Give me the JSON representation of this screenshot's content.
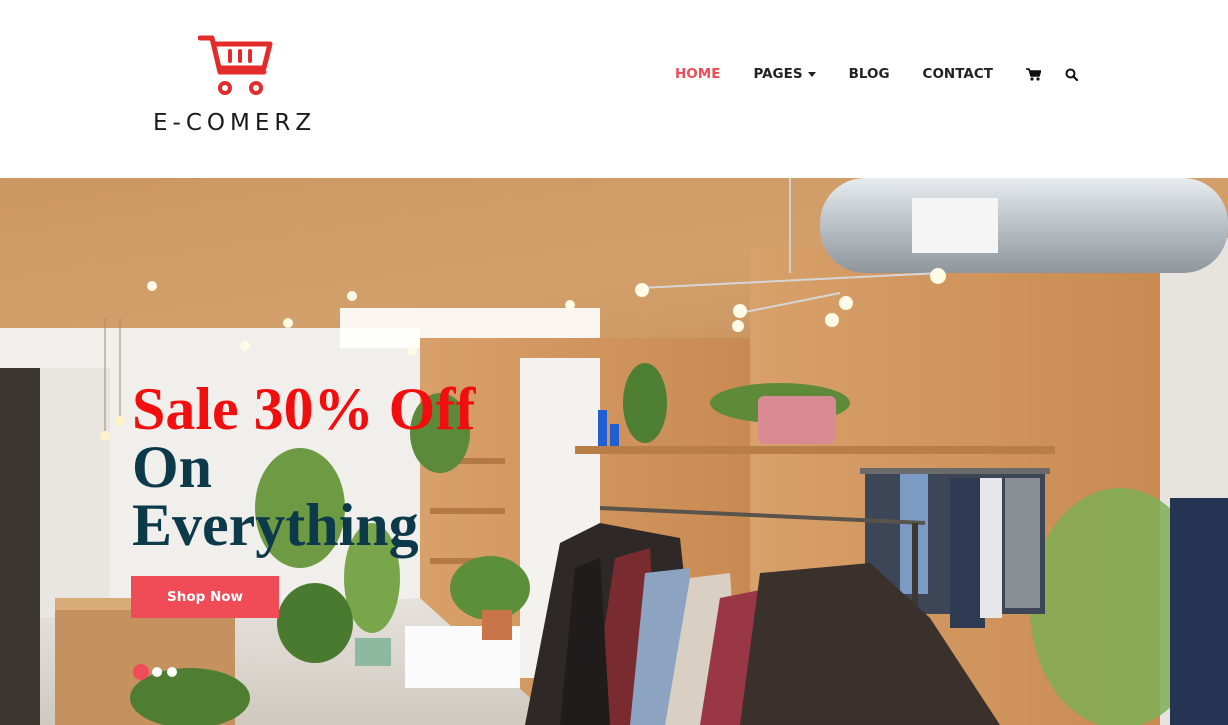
{
  "brand": {
    "name": "E-COMERZ",
    "accent": "#f04c58",
    "logo_icon": "shopping-cart-icon"
  },
  "nav": {
    "items": [
      {
        "label": "HOME",
        "active": true
      },
      {
        "label": "PAGES",
        "has_dropdown": true
      },
      {
        "label": "BLOG"
      },
      {
        "label": "CONTACT"
      }
    ],
    "icons": [
      "cart-icon",
      "search-icon"
    ]
  },
  "hero": {
    "headline_line1": "Sale 30% Off",
    "headline_line2": "On",
    "headline_line3": "Everything",
    "headline_colors": {
      "line1": "#f20e0e",
      "rest": "#0d3a4a"
    },
    "button_label": "Shop Now",
    "slides": {
      "count": 3,
      "active": 1
    },
    "background": "clothing store interior with wooden walls, clothing racks and plants"
  }
}
